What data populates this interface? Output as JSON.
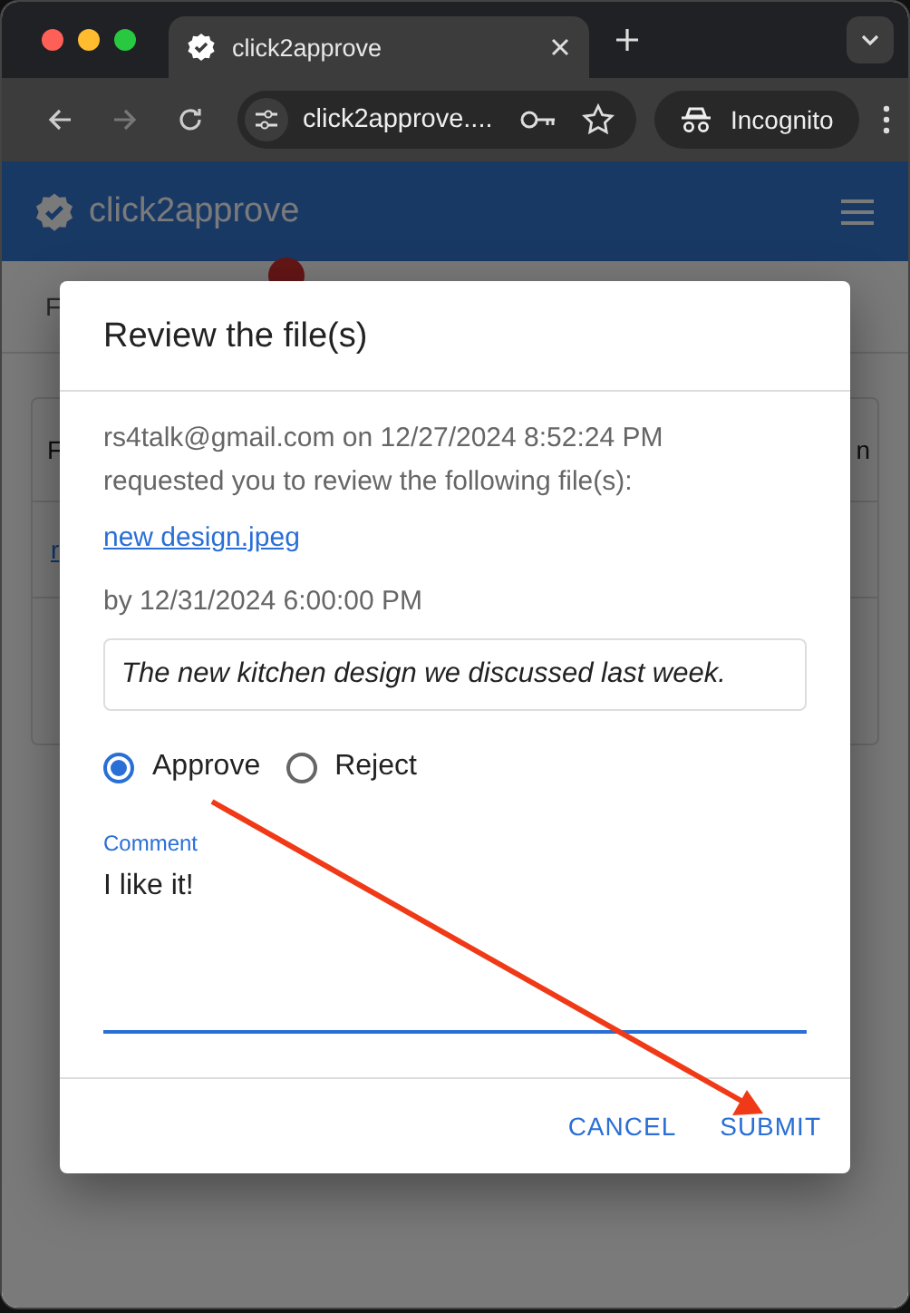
{
  "browser": {
    "tab_title": "click2approve",
    "address": "click2approve....",
    "profile": "Incognito",
    "forward_disabled": true
  },
  "app": {
    "brand": "click2approve",
    "tab_label": "F",
    "column_headers": [
      "F",
      "n"
    ],
    "cell_link": "r"
  },
  "dialog": {
    "title": "Review the file(s)",
    "request": "rs4talk@gmail.com on 12/27/2024 8:52:24 PM requested you to review the following file(s):",
    "file_link": "new design.jpeg",
    "due": "by 12/31/2024 6:00:00 PM",
    "message": "The new kitchen design we discussed last week.",
    "choices": [
      {
        "label": "Approve",
        "selected": true
      },
      {
        "label": "Reject",
        "selected": false
      }
    ],
    "comment": {
      "label": "Comment",
      "value": "I like it!"
    },
    "buttons": [
      "CANCEL",
      "SUBMIT"
    ]
  }
}
